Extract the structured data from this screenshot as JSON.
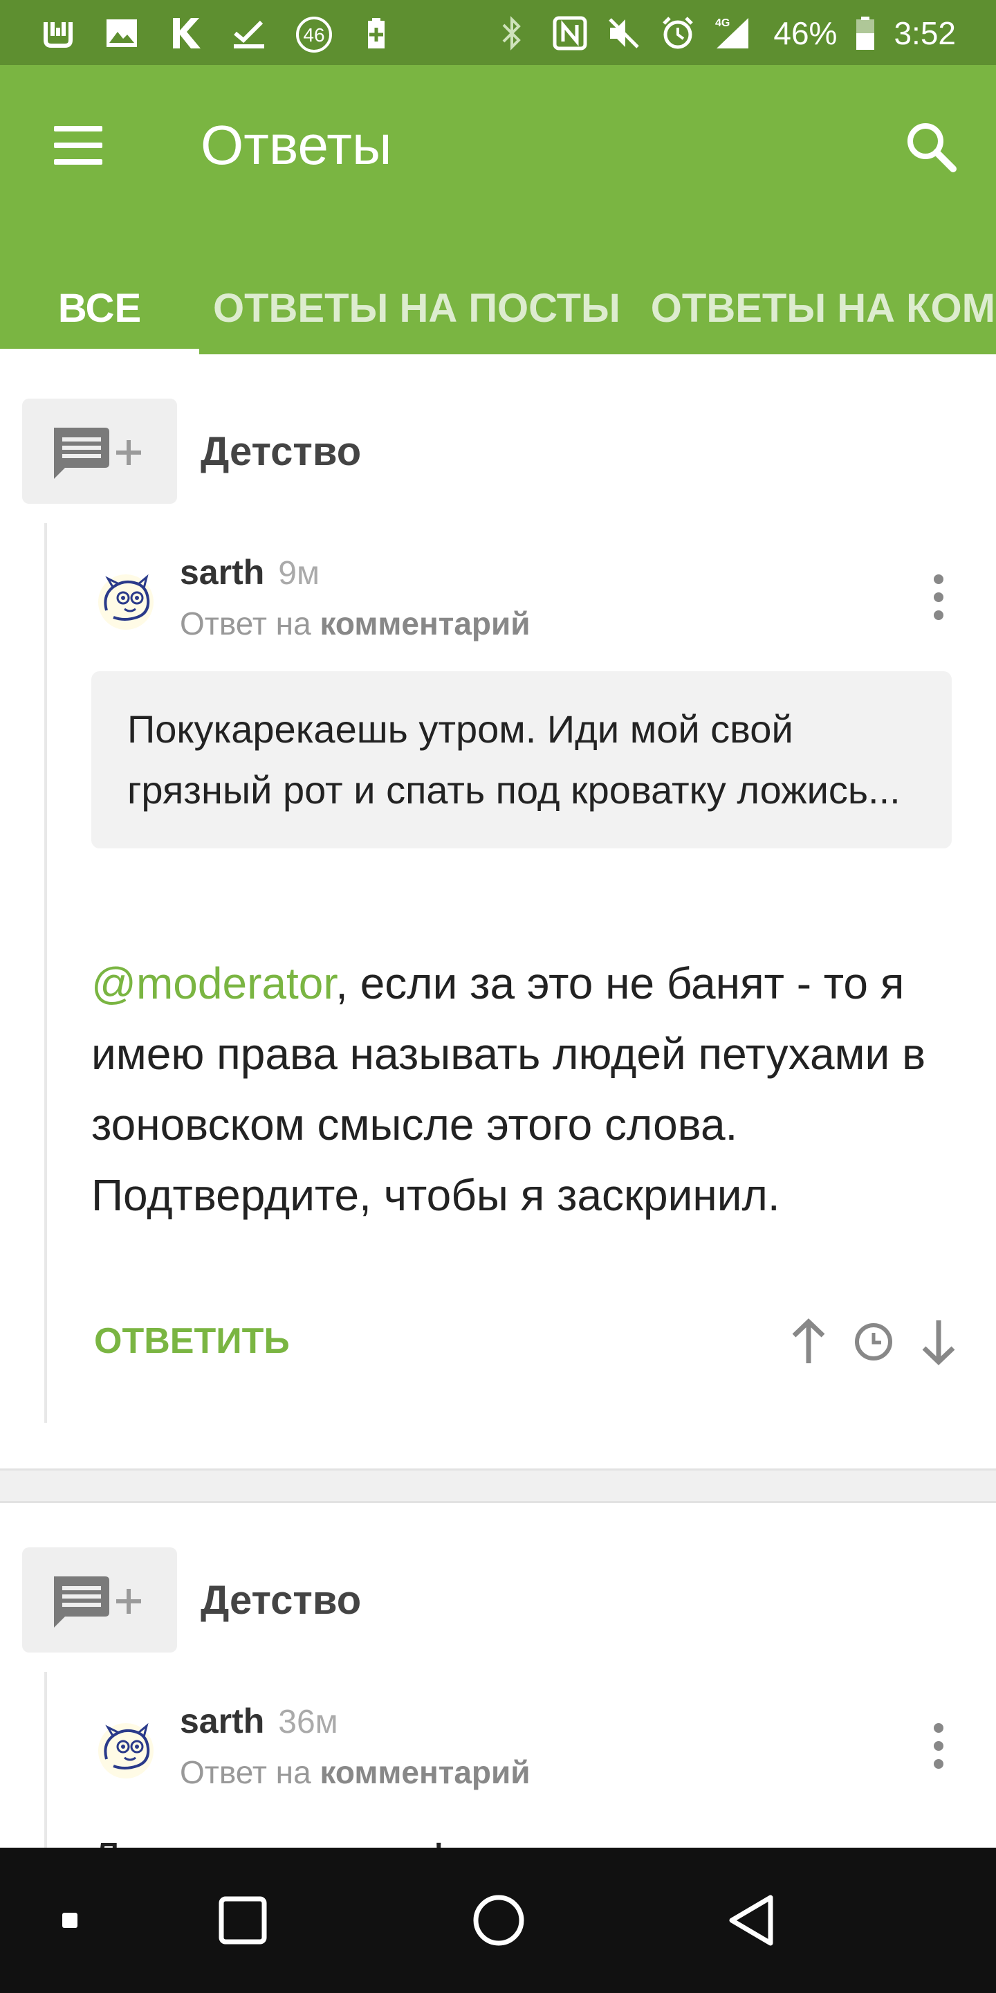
{
  "status_bar": {
    "battery_percent": "46%",
    "time": "3:52",
    "network": "4G",
    "notification_badge": "46",
    "left_icons": [
      "mi-icon",
      "image-icon",
      "k-icon",
      "check-icon",
      "badge-icon",
      "battery-saver-icon"
    ],
    "right_icons": [
      "bluetooth-icon",
      "nfc-icon",
      "mute-icon",
      "alarm-icon",
      "signal-icon",
      "battery-icon"
    ]
  },
  "app_bar": {
    "title": "Ответы",
    "menu_icon": "hamburger-icon",
    "search_icon": "search-icon",
    "color": "#7ab542"
  },
  "tabs": [
    {
      "label": "ВСЕ",
      "active": true
    },
    {
      "label": "ОТВЕТЫ НА ПОСТЫ",
      "active": false
    },
    {
      "label": "ОТВЕТЫ НА КОММЕНТАРИИ",
      "active": false
    }
  ],
  "cards": [
    {
      "section": "Детство",
      "author": "sarth",
      "time": "9м",
      "reply_prefix": "Ответ на",
      "reply_target": "комментарий",
      "quote": "Покукарекаешь утром. Иди мой свой грязный рот и спать под кроватку ложись...",
      "mention": "@moderator",
      "text": ", если за это не банят - то я имею права называть людей петухами в зоновском смысле этого слова. Подтвердите, чтобы я заскринил.",
      "reply_label": "ОТВЕТИТЬ"
    },
    {
      "section": "Детство",
      "author": "sarth",
      "time": "36м",
      "reply_prefix": "Ответ на",
      "reply_target": "комментарий",
      "text_partial": "Давите ажмемку!"
    }
  ],
  "nav_bar": {
    "buttons": [
      "recents-dot-icon",
      "square-icon",
      "circle-home-icon",
      "back-triangle-icon"
    ]
  },
  "colors": {
    "accent": "#7ab542",
    "status_bar": "#5e8f30",
    "nav_bar": "#111111"
  }
}
